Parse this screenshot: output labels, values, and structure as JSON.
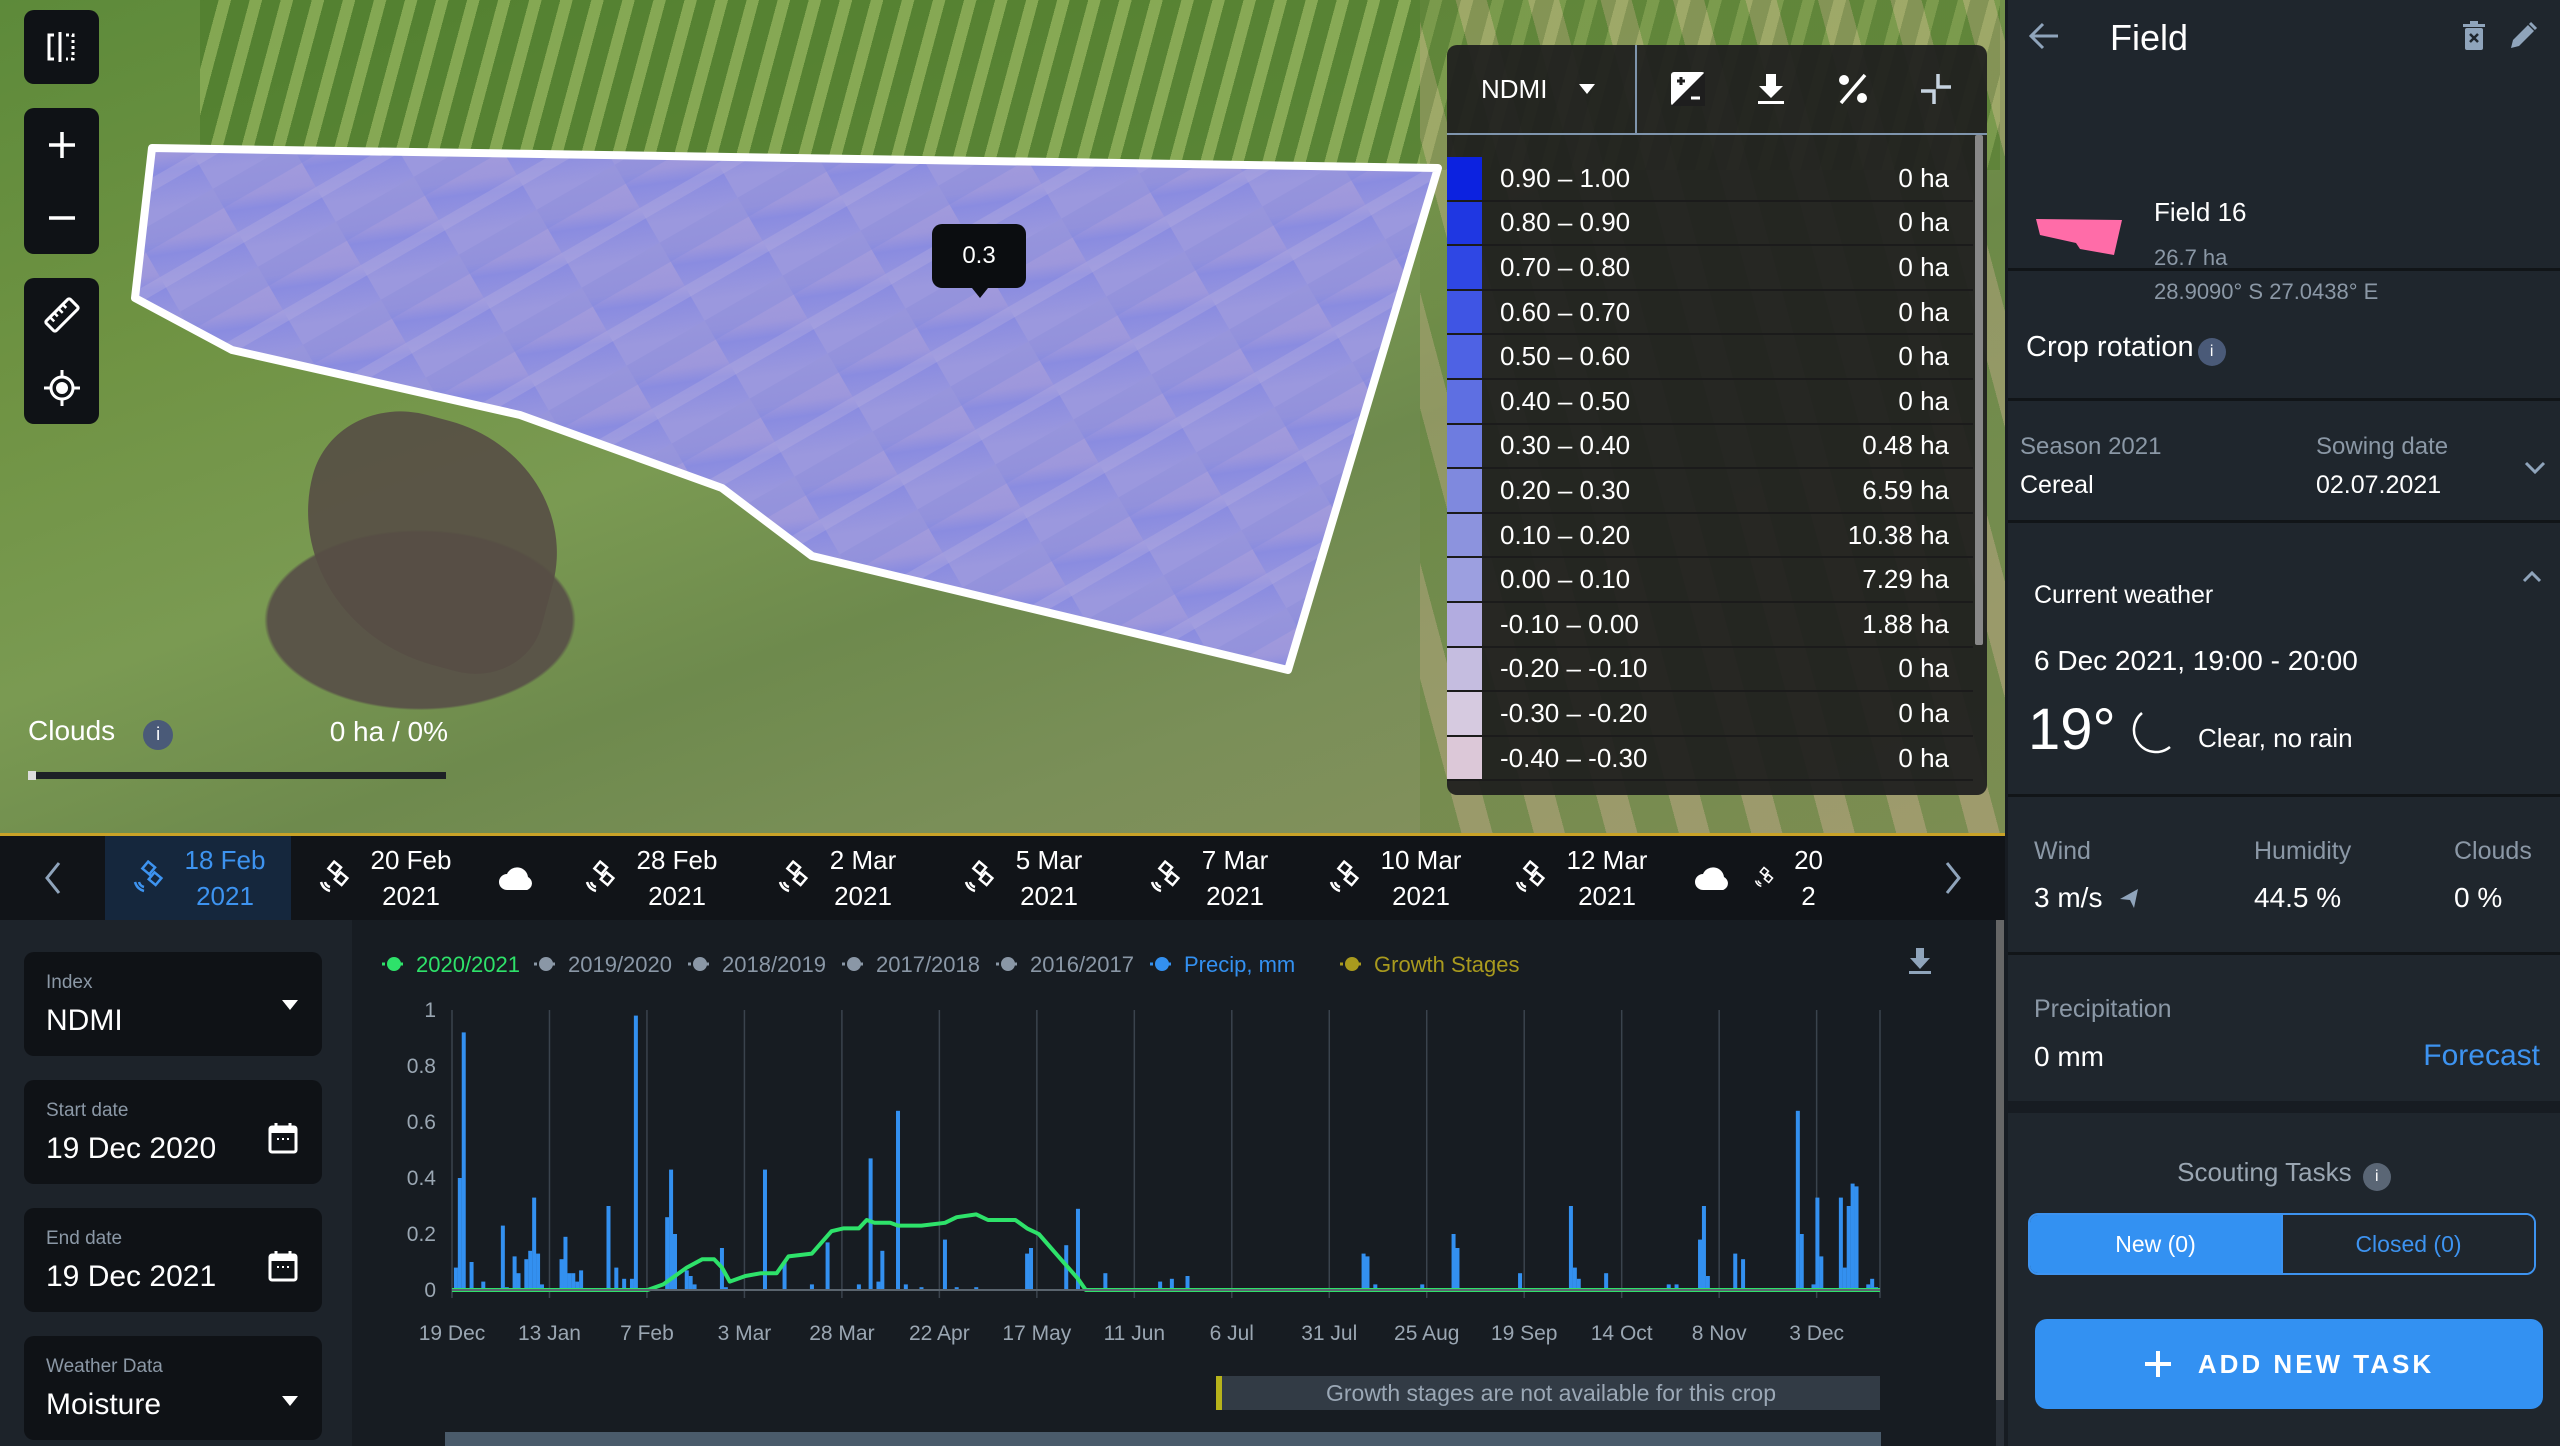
{
  "map": {
    "clouds": {
      "label": "Clouds",
      "info": "i",
      "value": "0 ha / 0%",
      "fraction": 0
    },
    "tooltip": "0.3",
    "legend": {
      "index": "NDMI",
      "rows": [
        {
          "range": "0.90 – 1.00",
          "value": "0 ha",
          "color": "#0c22e0"
        },
        {
          "range": "0.80 – 0.90",
          "value": "0 ha",
          "color": "#1f37e2"
        },
        {
          "range": "0.70 – 0.80",
          "value": "0 ha",
          "color": "#2f47e4"
        },
        {
          "range": "0.60 – 0.70",
          "value": "0 ha",
          "color": "#3f55e4"
        },
        {
          "range": "0.50 – 0.60",
          "value": "0 ha",
          "color": "#4e62e4"
        },
        {
          "range": "0.40 – 0.50",
          "value": "0 ha",
          "color": "#5e6fe2"
        },
        {
          "range": "0.30 – 0.40",
          "value": "0.48 ha",
          "color": "#6e7ce0"
        },
        {
          "range": "0.20 – 0.30",
          "value": "6.59 ha",
          "color": "#7f89de"
        },
        {
          "range": "0.10 – 0.20",
          "value": "10.38 ha",
          "color": "#8c93de"
        },
        {
          "range": "0.00 – 0.10",
          "value": "7.29 ha",
          "color": "#9c9fe0"
        },
        {
          "range": "-0.10 – 0.00",
          "value": "1.88 ha",
          "color": "#b2ace0"
        },
        {
          "range": "-0.20 – -0.10",
          "value": "0 ha",
          "color": "#c5bde0"
        },
        {
          "range": "-0.30 – -0.20",
          "value": "0 ha",
          "color": "#d6cae0"
        },
        {
          "range": "-0.40 – -0.30",
          "value": "0 ha",
          "color": "#dcc8d8"
        }
      ]
    }
  },
  "dates": [
    {
      "label": [
        "18 Feb",
        "2021"
      ],
      "type": "satellite",
      "active": true
    },
    {
      "label": [
        "20 Feb",
        "2021"
      ],
      "type": "satellite"
    },
    {
      "label": [],
      "type": "cloud"
    },
    {
      "label": [
        "28 Feb",
        "2021"
      ],
      "type": "satellite"
    },
    {
      "label": [
        "2 Mar",
        "2021"
      ],
      "type": "satellite"
    },
    {
      "label": [
        "5 Mar",
        "2021"
      ],
      "type": "satellite"
    },
    {
      "label": [
        "7 Mar",
        "2021"
      ],
      "type": "satellite"
    },
    {
      "label": [
        "10 Mar",
        "2021"
      ],
      "type": "satellite"
    },
    {
      "label": [
        "12 Mar",
        "2021"
      ],
      "type": "satellite"
    },
    {
      "label": [],
      "type": "cloud"
    },
    {
      "label": [
        "20",
        "2"
      ],
      "type": "satellite"
    }
  ],
  "controls": {
    "index": {
      "label": "Index",
      "value": "NDMI"
    },
    "start": {
      "label": "Start date",
      "value": "19 Dec 2020"
    },
    "end": {
      "label": "End date",
      "value": "19 Dec 2021"
    },
    "weather": {
      "label": "Weather Data",
      "value": "Moisture"
    }
  },
  "chart_data": {
    "type": "bar",
    "title": "",
    "xlabel": "",
    "ylabel": "",
    "ylim": [
      0,
      1
    ],
    "yticks": [
      "0",
      "0.2",
      "0.4",
      "0.6",
      "0.8",
      "1"
    ],
    "xticks": [
      "19 Dec",
      "13 Jan",
      "7 Feb",
      "3 Mar",
      "28 Mar",
      "22 Apr",
      "17 May",
      "11 Jun",
      "6 Jul",
      "31 Jul",
      "25 Aug",
      "19 Sep",
      "14 Oct",
      "8 Nov",
      "3 Dec"
    ],
    "x_days_range": [
      0,
      365
    ],
    "grid": true,
    "legend_position": "top-left",
    "legend": [
      {
        "name": "2020/2021",
        "color": "#2ee26a",
        "active": true
      },
      {
        "name": "2019/2020",
        "color": "#8a97a6",
        "active": false
      },
      {
        "name": "2018/2019",
        "color": "#8a97a6",
        "active": false
      },
      {
        "name": "2017/2018",
        "color": "#8a97a6",
        "active": false
      },
      {
        "name": "2016/2017",
        "color": "#8a97a6",
        "active": false
      },
      {
        "name": "Precip, mm",
        "color": "#3390f0",
        "active": true
      },
      {
        "name": "Growth Stages",
        "color": "#a99a1e",
        "active": true
      }
    ],
    "series": [
      {
        "name": "2020/2021",
        "type": "line",
        "color": "#2ee26a",
        "points": [
          [
            0,
            0
          ],
          [
            50,
            0
          ],
          [
            54,
            0.02
          ],
          [
            60,
            0.08
          ],
          [
            64,
            0.11
          ],
          [
            67,
            0.11
          ],
          [
            69,
            0.08
          ],
          [
            71,
            0.03
          ],
          [
            75,
            0.05
          ],
          [
            79,
            0.06
          ],
          [
            83,
            0.06
          ],
          [
            86,
            0.12
          ],
          [
            92,
            0.13
          ],
          [
            97,
            0.21
          ],
          [
            100,
            0.22
          ],
          [
            104,
            0.22
          ],
          [
            106,
            0.25
          ],
          [
            108,
            0.24
          ],
          [
            112,
            0.24
          ],
          [
            114,
            0.23
          ],
          [
            120,
            0.23
          ],
          [
            126,
            0.24
          ],
          [
            129,
            0.26
          ],
          [
            134,
            0.27
          ],
          [
            137,
            0.25
          ],
          [
            144,
            0.25
          ],
          [
            147,
            0.22
          ],
          [
            150,
            0.2
          ],
          [
            155,
            0.12
          ],
          [
            160,
            0.04
          ],
          [
            162,
            0
          ],
          [
            365,
            0
          ]
        ]
      },
      {
        "name": "Precip, mm",
        "type": "bar",
        "color": "#3390f0",
        "points": [
          [
            1,
            0.08
          ],
          [
            2,
            0.4
          ],
          [
            3,
            0.92
          ],
          [
            5,
            0.1
          ],
          [
            8,
            0.03
          ],
          [
            13,
            0.23
          ],
          [
            14,
            0.01
          ],
          [
            16,
            0.12
          ],
          [
            17,
            0.06
          ],
          [
            19,
            0.11
          ],
          [
            20,
            0.14
          ],
          [
            21,
            0.33
          ],
          [
            22,
            0.13
          ],
          [
            23,
            0.02
          ],
          [
            28,
            0.11
          ],
          [
            29,
            0.19
          ],
          [
            30,
            0.06
          ],
          [
            31,
            0.06
          ],
          [
            32,
            0.03
          ],
          [
            33,
            0.07
          ],
          [
            40,
            0.3
          ],
          [
            42,
            0.08
          ],
          [
            44,
            0.04
          ],
          [
            46,
            0.04
          ],
          [
            47,
            0.98
          ],
          [
            55,
            0.26
          ],
          [
            56,
            0.43
          ],
          [
            57,
            0.2
          ],
          [
            60,
            0.07
          ],
          [
            61,
            0.05
          ],
          [
            62,
            0.02
          ],
          [
            69,
            0.15
          ],
          [
            70,
            0.01
          ],
          [
            80,
            0.43
          ],
          [
            85,
            0.1
          ],
          [
            92,
            0.02
          ],
          [
            96,
            0.17
          ],
          [
            104,
            0.02
          ],
          [
            107,
            0.47
          ],
          [
            109,
            0.03
          ],
          [
            110,
            0.14
          ],
          [
            114,
            0.64
          ],
          [
            116,
            0.02
          ],
          [
            120,
            0.01
          ],
          [
            126,
            0.18
          ],
          [
            129,
            0.01
          ],
          [
            134,
            0.01
          ],
          [
            147,
            0.13
          ],
          [
            148,
            0.15
          ],
          [
            157,
            0.16
          ],
          [
            160,
            0.29
          ],
          [
            167,
            0.06
          ],
          [
            181,
            0.03
          ],
          [
            184,
            0.04
          ],
          [
            188,
            0.05
          ],
          [
            233,
            0.13
          ],
          [
            234,
            0.12
          ],
          [
            236,
            0.02
          ],
          [
            248,
            0.02
          ],
          [
            256,
            0.2
          ],
          [
            257,
            0.15
          ],
          [
            273,
            0.06
          ],
          [
            286,
            0.3
          ],
          [
            287,
            0.08
          ],
          [
            288,
            0.04
          ],
          [
            295,
            0.06
          ],
          [
            311,
            0.02
          ],
          [
            313,
            0.02
          ],
          [
            319,
            0.18
          ],
          [
            320,
            0.3
          ],
          [
            321,
            0.05
          ],
          [
            328,
            0.13
          ],
          [
            330,
            0.11
          ],
          [
            344,
            0.64
          ],
          [
            345,
            0.2
          ],
          [
            348,
            0.02
          ],
          [
            349,
            0.33
          ],
          [
            350,
            0.12
          ],
          [
            355,
            0.33
          ],
          [
            356,
            0.08
          ],
          [
            357,
            0.3
          ],
          [
            358,
            0.38
          ],
          [
            359,
            0.37
          ],
          [
            362,
            0.02
          ],
          [
            363,
            0.04
          ],
          [
            364,
            0.01
          ]
        ]
      }
    ],
    "note": "Growth stages are not available for this crop"
  },
  "panel": {
    "title": "Field",
    "field": {
      "name": "Field 16",
      "area": "26.7 ha",
      "coords": "28.9090° S 27.0438° E",
      "shape_color": "#ff6ca8"
    },
    "crop_rotation": "Crop rotation",
    "season": {
      "label": "Season 2021",
      "crop": "Cereal",
      "sowing_label": "Sowing date",
      "sowing": "02.07.2021"
    },
    "weather": {
      "title": "Current weather",
      "datetime": "6 Dec 2021, 19:00 - 20:00",
      "temp": "19°",
      "condition": "Clear, no rain",
      "wind_label": "Wind",
      "wind": "3 m/s",
      "humidity_label": "Humidity",
      "humidity": "44.5 %",
      "clouds_label": "Clouds",
      "clouds": "0 %",
      "precip_label": "Precipitation",
      "precip": "0 mm",
      "forecast": "Forecast"
    },
    "scouting": {
      "title": "Scouting Tasks",
      "new": "New (0)",
      "closed": "Closed (0)",
      "add": "ADD NEW TASK"
    }
  },
  "colors": {
    "accent": "#3391f2",
    "bg": "#1f262d",
    "active_line": "#2ee26a"
  }
}
